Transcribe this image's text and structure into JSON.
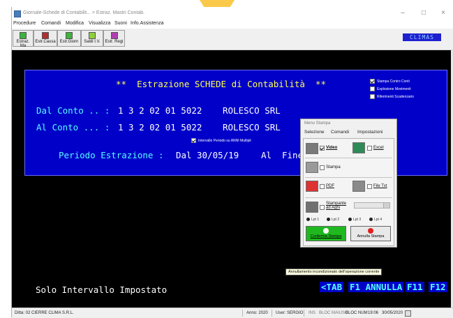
{
  "window": {
    "title": "Giornale-Schede di Contabilit... > Estraz. Mastri Contab.",
    "minimize": "–",
    "maximize": "□",
    "close": "×"
  },
  "menubar": [
    "Procedure",
    "Comandi",
    "Modifica",
    "Visualizza",
    "Suoni",
    "Info.Assistenza"
  ],
  "toolbar": [
    {
      "label": "Estraz. Ma",
      "icon": "extract-icon"
    },
    {
      "label": "Estr.Causa",
      "icon": "book-icon"
    },
    {
      "label": "Estr.Giorn",
      "icon": "journal-icon"
    },
    {
      "label": "Saldi I.V.",
      "icon": "balance-icon"
    },
    {
      "label": "Estr. Regi",
      "icon": "register-icon"
    }
  ],
  "brand": "CLIMAS",
  "form": {
    "title": "**  Estrazione SCHEDE di Contabilità  **",
    "dal_label": "Dal Conto .. :",
    "dal_code": "1 3 2 02 01 5022",
    "dal_name": "ROLESCO SRL",
    "al_label": "Al Conto ... :",
    "al_code": "1 3 2 02 01 5022",
    "al_name": "ROLESCO SRL",
    "periodo_label": "Periodo Estrazione :",
    "dal_word": "Dal",
    "dal_date": "30/05/19",
    "al_word": "Al",
    "al_date_partial": "Fine",
    "interval_option": "Intervallo Periodo su ANNI Multipli",
    "options": [
      {
        "label": "Stampa Contro Conti",
        "checked": true
      },
      {
        "label": "Esplosione Movimenti",
        "checked": false
      },
      {
        "label": "Riferimenti Scadenzario",
        "checked": false
      }
    ]
  },
  "bottom": {
    "message": "Solo Intervallo Impostato",
    "keys": [
      "<TAB",
      "F1 ANNULLA",
      "F11",
      "F12"
    ]
  },
  "tooltip": "Annullamento incondizionato dell'operazione corrente",
  "dialog": {
    "title": "Menu Stampa",
    "menu": [
      "Selezione",
      "Comandi",
      "Impostazioni"
    ],
    "video": {
      "label": "Video",
      "checked": true
    },
    "excel": {
      "label": "Excel",
      "checked": false
    },
    "stampa": {
      "label": "Stampa",
      "checked": false
    },
    "pdf": {
      "label": "PDF",
      "checked": false
    },
    "file_txt": {
      "label": "File Txt",
      "checked": false
    },
    "stampante_aghi": {
      "label": "Stampante ad Aghi",
      "checked": false
    },
    "lpt": [
      "Lpt 1",
      "Lpt 2",
      "Lpt 3",
      "Lpt 4"
    ],
    "confirm": "Conferma Stampa",
    "cancel": "Annulla Stampa"
  },
  "status": {
    "ditta": "Ditta: 02 CIERRE CLIMA S.R.L.",
    "anno": "Anno: 2020",
    "user": "User: SERGIO",
    "ins": "INS",
    "bloc_maiusc": "BLOC MAIUSC",
    "bloc_num": "BLOC NUM",
    "time": "19:06",
    "date": "30/05/2020"
  },
  "colors": {
    "panel_blue": "#0000c8",
    "title_yellow": "#ffff54",
    "field_cyan": "#55ffff",
    "highlight": "#fbc94a",
    "confirm_green": "#1fb81f",
    "cancel_red": "#e02020"
  }
}
